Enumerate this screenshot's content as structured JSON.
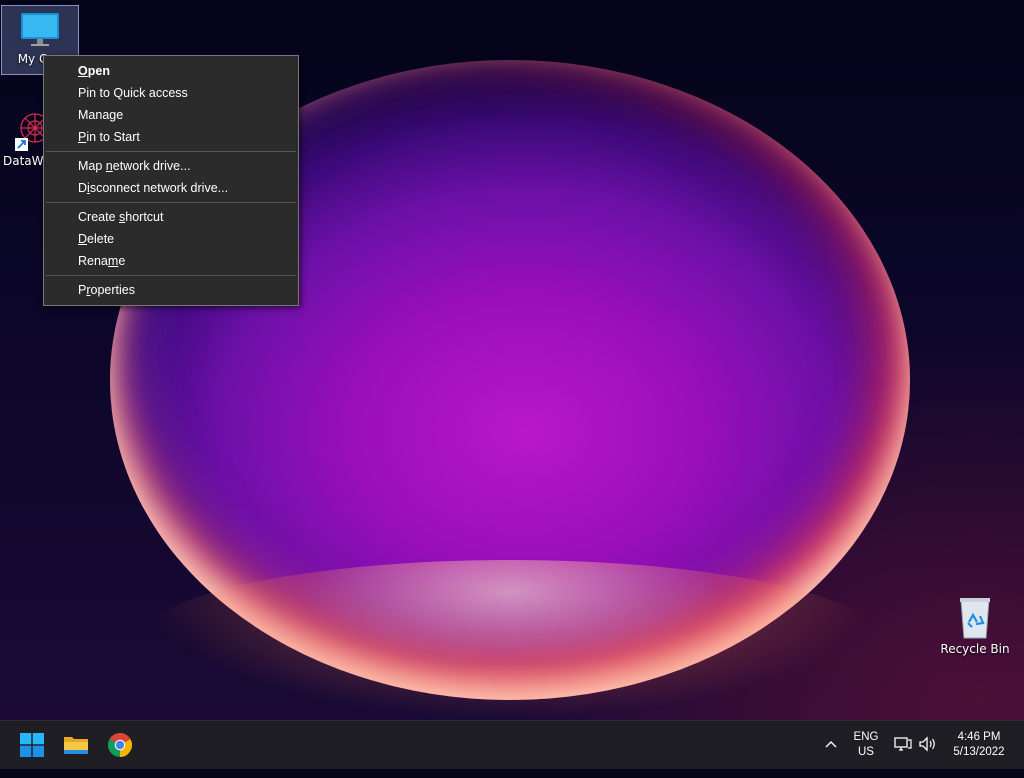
{
  "desktop": {
    "icons": [
      {
        "label": "My Computer",
        "shown_label": "My Con",
        "icon": "monitor-icon"
      },
      {
        "label": "DataWa",
        "icon": "datawarrior-icon"
      },
      {
        "label": "Recycle Bin",
        "icon": "recycle-bin-icon"
      }
    ]
  },
  "context_menu": {
    "groups": [
      [
        {
          "label": "Open",
          "bold": true,
          "accel": "O"
        },
        {
          "label": "Pin to Quick access"
        },
        {
          "label": "Manage"
        },
        {
          "label": "Pin to Start",
          "accel": "P"
        }
      ],
      [
        {
          "label": "Map network drive...",
          "accel": "n"
        },
        {
          "label": "Disconnect network drive...",
          "accel": "i"
        }
      ],
      [
        {
          "label": "Create shortcut",
          "accel": "s"
        },
        {
          "label": "Delete",
          "accel": "D"
        },
        {
          "label": "Rename",
          "accel": "m"
        }
      ],
      [
        {
          "label": "Properties",
          "accel": "r"
        }
      ]
    ]
  },
  "taskbar": {
    "apps": [
      {
        "name": "Start",
        "icon": "windows-start-icon"
      },
      {
        "name": "File Explorer",
        "icon": "folder-icon"
      },
      {
        "name": "Google Chrome",
        "icon": "chrome-icon"
      }
    ],
    "tray": {
      "chevron_icon": "chevron-up-icon",
      "lang_top": "ENG",
      "lang_bottom": "US",
      "network_icon": "network-icon",
      "volume_icon": "volume-icon",
      "time": "4:46 PM",
      "date": "5/13/2022"
    }
  },
  "colors": {
    "menu_bg": "#2b2b2b",
    "taskbar_bg": "#1e1e24",
    "accent_blue": "#2aa8f0"
  }
}
